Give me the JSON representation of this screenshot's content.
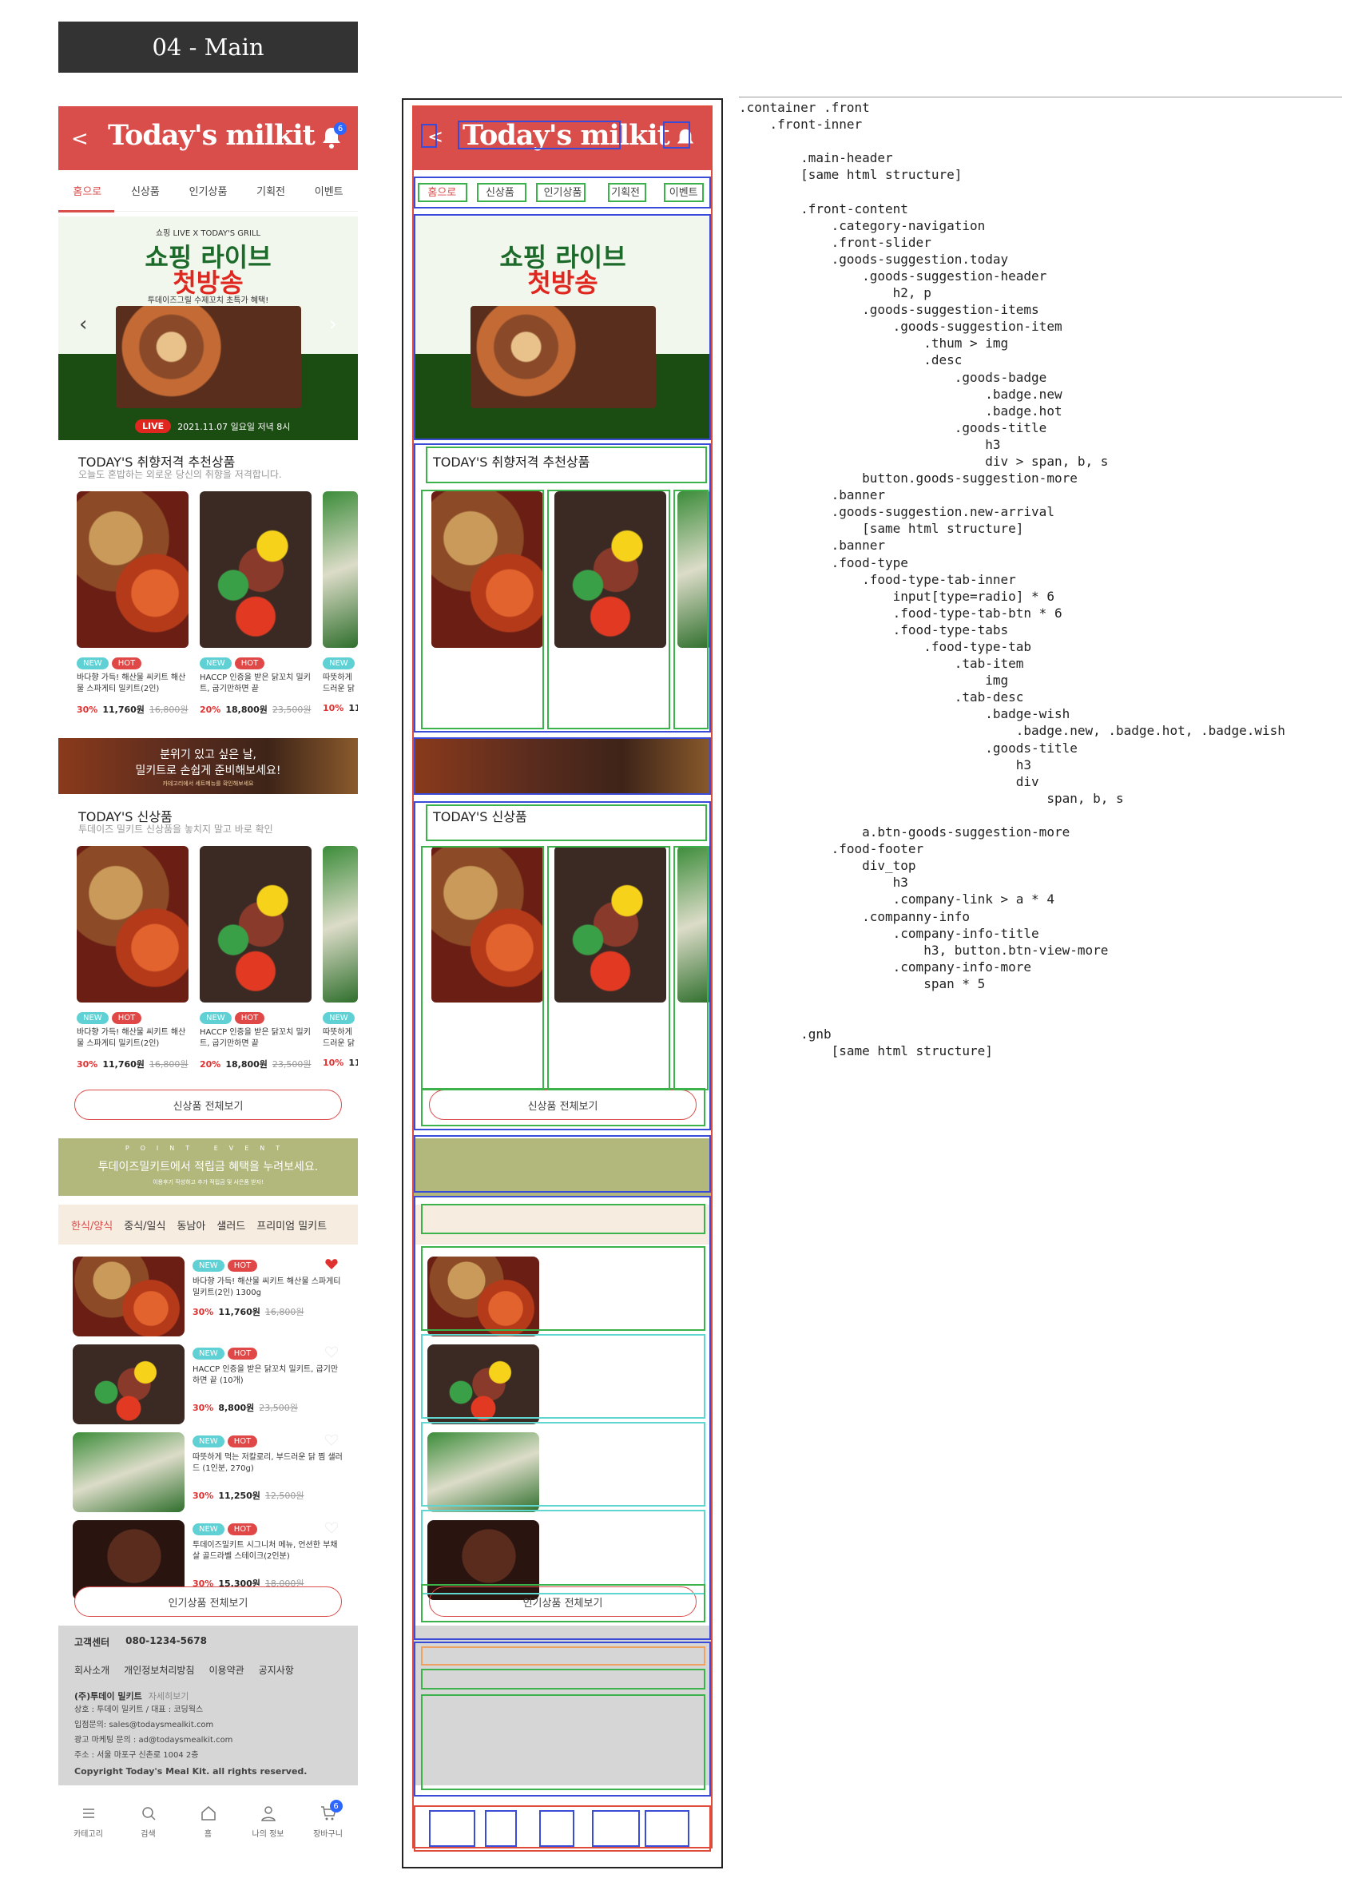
{
  "page_label": "04 - Main",
  "header": {
    "back": "<",
    "brand": "Today's milkit",
    "bell_count": "6"
  },
  "category_nav": [
    "홈으로",
    "신상품",
    "인기상품",
    "기획전",
    "이벤트"
  ],
  "slider": {
    "top_line": "쇼핑 LIVE X TODAY'S GRILL",
    "title1": "쇼핑 라이브",
    "title2": "첫방송",
    "sub": "투데이즈그릴 수제꼬치 초특가 혜택!",
    "live_badge": "LIVE",
    "live_time": "2021.11.07 일요일 저녁 8시",
    "prev": "‹",
    "next": "›"
  },
  "today": {
    "title": "TODAY'S 취향저격 추천상품",
    "sub": "오늘도 혼밥하는 외로운 당신의 취향을 저격합니다.",
    "items": [
      {
        "new": "NEW",
        "hot": "HOT",
        "name": "바다향 가득! 해산물 씨키트 해산물 스파게티 밀키트(2인)",
        "disc": "30%",
        "sale": "11,760원",
        "orig": "16,800원"
      },
      {
        "new": "NEW",
        "hot": "HOT",
        "name": "HACCP 인증을 받은 닭꼬치 밀키트, 굽기만하면 끝",
        "disc": "20%",
        "sale": "18,800원",
        "orig": "23,500원"
      },
      {
        "new": "NEW",
        "hot": "",
        "name": "따뜻하게 드러운 닭",
        "disc": "10%",
        "sale": "11",
        "orig": ""
      }
    ]
  },
  "banner1": {
    "line1": "분위기 있고 싶은 날,",
    "line2": "밀키트로 손쉽게 준비해보세요!",
    "line3": "카테고리에서 세트메뉴를 확인해보세요"
  },
  "new_arrival": {
    "title": "TODAY'S 신상품",
    "sub": "투데이즈 밀키트 신상품을 놓치지 말고 바로 확인",
    "items": [
      {
        "new": "NEW",
        "hot": "HOT",
        "name": "바다향 가득! 해산물 씨키트 해산물 스파게티 밀키트(2인)",
        "disc": "30%",
        "sale": "11,760원",
        "orig": "16,800원"
      },
      {
        "new": "NEW",
        "hot": "HOT",
        "name": "HACCP 인증을 받은 닭꼬치 밀키트, 굽기만하면 끝",
        "disc": "20%",
        "sale": "18,800원",
        "orig": "23,500원"
      },
      {
        "new": "NEW",
        "hot": "",
        "name": "따뜻하게 드러운 닭",
        "disc": "10%",
        "sale": "11",
        "orig": ""
      }
    ],
    "more": "신상품 전체보기"
  },
  "banner2": {
    "point": "POINT EVENT",
    "main": "투데이즈밀키트에서 적립금 혜택을 누려보세요.",
    "small": "이용후기 작성하고 추가 적립금 및 사은품 받자!"
  },
  "food_type": {
    "tabs": [
      "한식/양식",
      "중식/일식",
      "동남아",
      "샐러드",
      "프리미엄 밀키트"
    ],
    "items": [
      {
        "new": "NEW",
        "hot": "HOT",
        "name": "바다향 가득! 해산물 씨키트 해산물 스파게티 밀키트(2인) 1300g",
        "disc": "30%",
        "sale": "11,760원",
        "orig": "16,800원",
        "wish": true
      },
      {
        "new": "NEW",
        "hot": "HOT",
        "name": "HACCP 인증을 받은 닭꼬치 밀키트, 굽기만 하면 끝 (10개)",
        "disc": "30%",
        "sale": "8,800원",
        "orig": "23,500원",
        "wish": false
      },
      {
        "new": "NEW",
        "hot": "HOT",
        "name": "따뜻하게 먹는 저칼로리, 부드러운 닭 찜 샐러드 (1인분, 270g)",
        "disc": "30%",
        "sale": "11,250원",
        "orig": "12,500원",
        "wish": false
      },
      {
        "new": "NEW",
        "hot": "HOT",
        "name": "투데이즈밀키트 시그니처 메뉴, 언션한 부채살 골드라벨 스테이크(2인분)",
        "disc": "30%",
        "sale": "15,300원",
        "orig": "18,000원",
        "wish": false
      }
    ],
    "more": "인기상품 전체보기"
  },
  "footer": {
    "cs_label": "고객센터",
    "cs_phone": "080-1234-5678",
    "links": [
      "회사소개",
      "개인정보처리방침",
      "이용약관",
      "공지사항"
    ],
    "company": "(주)투데이 밀키트",
    "company_more": "자세히보기",
    "lines": [
      "상호 : 투데이 밀키트 / 대표 : 코딩웍스",
      "입점문의: sales@todaysmealkit.com",
      "광고 마케팅 문의 : ad@todaysmealkit.com",
      "주소 : 서울 마포구 신촌로 1004 2층"
    ],
    "copyright": "Copyright Today's Meal Kit. all rights reserved."
  },
  "tabbar": [
    {
      "label": "카테고리",
      "icon": "menu-icon"
    },
    {
      "label": "검색",
      "icon": "search-icon"
    },
    {
      "label": "홈",
      "icon": "home-icon"
    },
    {
      "label": "나의 정보",
      "icon": "user-icon"
    },
    {
      "label": "장바구니",
      "icon": "cart-icon",
      "badge": "6"
    }
  ],
  "structure_code": [
    ".container .front",
    "    .front-inner",
    "",
    "        .main-header",
    "        [same html structure]",
    "",
    "        .front-content",
    "            .category-navigation",
    "            .front-slider",
    "            .goods-suggestion.today",
    "                .goods-suggestion-header",
    "                    h2, p",
    "                .goods-suggestion-items",
    "                    .goods-suggestion-item",
    "                        .thum > img",
    "                        .desc",
    "                            .goods-badge",
    "                                .badge.new",
    "                                .badge.hot",
    "                            .goods-title",
    "                                h3",
    "                                div > span, b, s",
    "                button.goods-suggestion-more",
    "            .banner",
    "            .goods-suggestion.new-arrival",
    "                [same html structure]",
    "            .banner",
    "            .food-type",
    "                .food-type-tab-inner",
    "                    input[type=radio] * 6",
    "                    .food-type-tab-btn * 6",
    "                    .food-type-tabs",
    "                        .food-type-tab",
    "                            .tab-item",
    "                                img",
    "                            .tab-desc",
    "                                .badge-wish",
    "                                    .badge.new, .badge.hot, .badge.wish",
    "                                .goods-title",
    "                                    h3",
    "                                    div",
    "                                        span, b, s",
    "",
    "                a.btn-goods-suggestion-more",
    "            .food-footer",
    "                div_top",
    "                    h3",
    "                    .company-link > a * 4",
    "                .companny-info",
    "                    .company-info-title",
    "                        h3, button.btn-view-more",
    "                    .company-info-more",
    "                        span * 5",
    "",
    "",
    "        .gnb",
    "            [same html structure]"
  ]
}
